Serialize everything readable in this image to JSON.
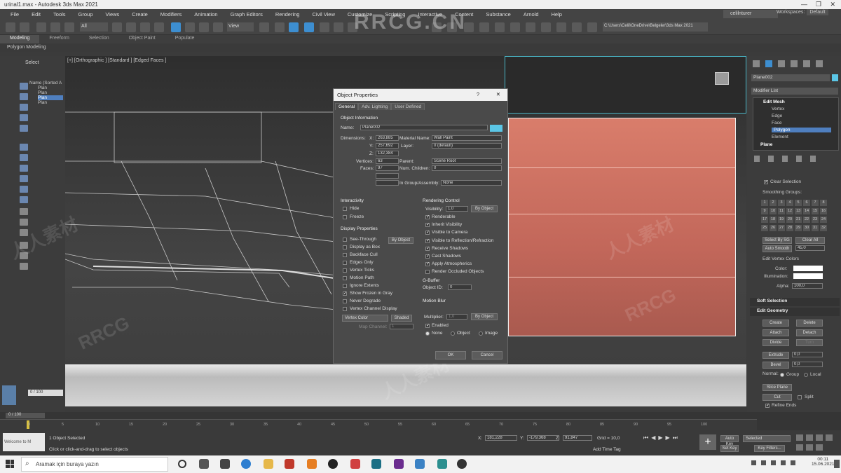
{
  "window": {
    "title": "urinal1.max - Autodesk 3ds Max 2021",
    "user": "celilnturer",
    "workspace_label": "Workspaces:",
    "workspace_value": "Default"
  },
  "menu": [
    "File",
    "Edit",
    "Tools",
    "Group",
    "Views",
    "Create",
    "Modifiers",
    "Animation",
    "Graph Editors",
    "Rendering",
    "Civil View",
    "Customize",
    "Scripting",
    "Interactive",
    "Content",
    "Substance",
    "Arnold",
    "Help"
  ],
  "ribbon": {
    "tabs": [
      "Modeling",
      "Freeform",
      "Selection",
      "Object Paint",
      "Populate"
    ],
    "sub": "Polygon Modeling"
  },
  "toolbar": {
    "selection_filter": "All",
    "view": "View",
    "path": "C:\\Users\\Celil\\OneDrive\\Belgeler\\3ds Max 2021"
  },
  "left": {
    "select_label": "Select",
    "scene_header": "Name (Sorted A",
    "scene_items": [
      "Plan",
      "Plan",
      "Plan",
      "Plan"
    ]
  },
  "viewport": {
    "label": "[+] [Orthographic ] [Standard ] [Edged Faces ]"
  },
  "dialog": {
    "title": "Object Properties",
    "help": "?",
    "close": "✕",
    "tabs": [
      "General",
      "Adv. Lighting",
      "User Defined"
    ],
    "object_info": "Object Information",
    "name_label": "Name:",
    "name_value": "Plane002",
    "dimensions_label": "Dimensions:",
    "x_label": "X:",
    "x_value": "263,885",
    "y_label": "Y:",
    "y_value": "257,692",
    "z_label": "Z:",
    "z_value": "132,384",
    "material_label": "Material Name:",
    "material_value": "Wall Paint",
    "layer_label": "Layer:",
    "layer_value": "0 (default)",
    "vertices_label": "Vertices:",
    "vertices_value": "63",
    "faces_label": "Faces:",
    "faces_value": "97",
    "parent_label": "Parent:",
    "parent_value": "Scene Root",
    "children_label": "Num. Children:",
    "children_value": "0",
    "group_label": "In Group/Assembly:",
    "group_value": "None",
    "interactivity": "Interactivity",
    "hide": "Hide",
    "freeze": "Freeze",
    "display_props": "Display Properties",
    "by_object": "By Object",
    "display_items": [
      "See-Through",
      "Display as Box",
      "Backface Cull",
      "Edges Only",
      "Vertex Ticks",
      "Motion Path",
      "Ignore Extents",
      "Show Frozen in Gray",
      "Never Degrade",
      "Vertex Channel Display"
    ],
    "vertex_color": "Vertex Color",
    "shaded": "Shaded",
    "map_channel": "Map Channel:",
    "map_channel_value": "1",
    "rendering_control": "Rendering Control",
    "visibility_label": "Visibility:",
    "visibility_value": "1,0",
    "render_items": [
      "Renderable",
      "Inherit Visibility",
      "Visible to Camera",
      "Visible to Reflection/Refraction",
      "Receive Shadows",
      "Cast Shadows",
      "Apply Atmospherics",
      "Render Occluded Objects"
    ],
    "gbuffer": "G-Buffer",
    "object_id": "Object ID:",
    "object_id_value": "0",
    "motion_blur": "Motion Blur",
    "multiplier": "Multiplier:",
    "multiplier_value": "1,0",
    "enabled": "Enabled",
    "mb_none": "None",
    "mb_object": "Object",
    "mb_image": "Image",
    "ok": "OK",
    "cancel": "Cancel"
  },
  "right": {
    "object_name": "Plane002",
    "modifier_list": "Modifier List",
    "stack": [
      "Edit Mesh",
      "Vertex",
      "Edge",
      "Face",
      "Polygon",
      "Element",
      "Plane"
    ],
    "clear_selection": "Clear Selection",
    "smoothing_groups": "Smoothing Groups:",
    "sg_numbers": [
      "1",
      "2",
      "3",
      "4",
      "5",
      "6",
      "7",
      "8",
      "9",
      "10",
      "11",
      "12",
      "13",
      "14",
      "15",
      "16",
      "17",
      "18",
      "19",
      "20",
      "21",
      "22",
      "23",
      "24",
      "25",
      "26",
      "27",
      "28",
      "29",
      "30",
      "31",
      "32"
    ],
    "select_by_sg": "Select By SG",
    "clear_all": "Clear All",
    "auto_smooth": "Auto Smooth",
    "auto_smooth_value": "45,0",
    "edit_vertex_colors": "Edit Vertex Colors",
    "color": "Color:",
    "illumination": "Illumination:",
    "alpha": "Alpha:",
    "alpha_value": "100,0",
    "soft_selection": "Soft Selection",
    "edit_geometry": "Edit Geometry",
    "create": "Create",
    "delete": "Delete",
    "attach": "Attach",
    "detach": "Detach",
    "divide": "Divide",
    "turn": "Turn",
    "extrude": "Extrude",
    "bevel": "Bevel",
    "extrude_value": "0,0",
    "bevel_value": "0,0",
    "normal": "Normal:",
    "group": "Group",
    "local": "Local",
    "slice_plane": "Slice Plane",
    "split": "Split",
    "cut": "Cut",
    "refine_ends": "Refine Ends"
  },
  "timeline": {
    "frame": "0 / 100",
    "ticks": [
      "0",
      "5",
      "10",
      "15",
      "20",
      "25",
      "30",
      "35",
      "40",
      "45",
      "50",
      "55",
      "60",
      "65",
      "70",
      "75",
      "80",
      "85",
      "90",
      "95",
      "100"
    ]
  },
  "status": {
    "selected": "1 Object Selected",
    "hint": "Click or click-and-drag to select objects",
    "x_label": "X:",
    "x_value": "181,228",
    "y_label": "Y:",
    "y_value": "-179,368",
    "z_label": "Z:",
    "z_value": "91,847",
    "grid": "Grid = 10,0",
    "add_time_tag": "Add Time Tag",
    "auto_key": "Auto Key",
    "set_key": "Set Key",
    "selected_dd": "Selected",
    "key_filters": "Key Filters...",
    "script": "Welcome to M"
  },
  "taskbar": {
    "search_placeholder": "Aramak için buraya yazın",
    "time": "00:11",
    "date": "15.06.2021"
  },
  "watermark": {
    "main": "RRCG.CN",
    "alt1": "RRCG",
    "alt2": "人人素材"
  },
  "colors": {
    "accent": "#3d8ed0",
    "wall": "#c2675a",
    "selection": "#4f7fbf"
  }
}
